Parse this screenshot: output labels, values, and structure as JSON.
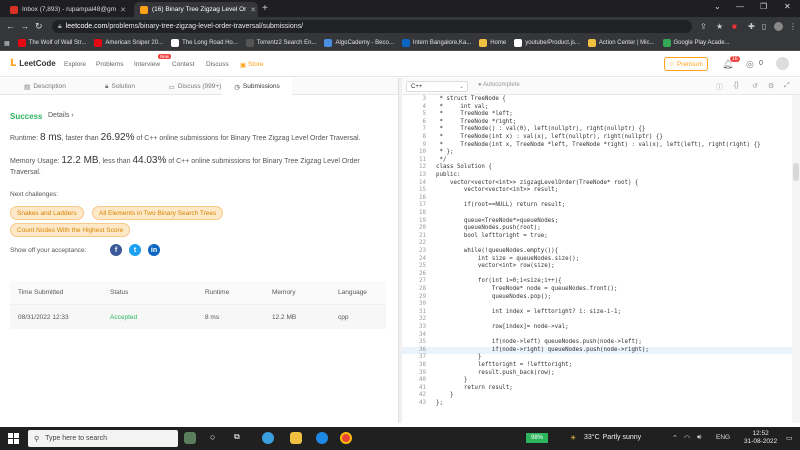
{
  "browser": {
    "tabs": [
      {
        "title": "Inbox (7,893) - rupampal48@gm",
        "favicon_color": "#d93025"
      },
      {
        "title": "(16) Binary Tree Zigzag Level Or",
        "favicon_color": "#ffa116"
      }
    ],
    "url_domain": "leetcode.com",
    "url_path": "/problems/binary-tree-zigzag-level-order-traversal/submissions/",
    "bookmarks": [
      {
        "label": "The Wolf of Wall Str...",
        "icon_color": "#e50914"
      },
      {
        "label": "American Sniper 20...",
        "icon_color": "#e50914"
      },
      {
        "label": "The Long Road Ho...",
        "icon_color": "#ffffff"
      },
      {
        "label": "Torrentz2 Search En...",
        "icon_color": "#333333"
      },
      {
        "label": "AlgoCademy - Beco...",
        "icon_color": "#4a90e2"
      },
      {
        "label": "Intern Bangalore,Ka...",
        "icon_color": "#0a66c2"
      },
      {
        "label": "Home",
        "icon_color": "#f0c040"
      },
      {
        "label": "youtube/Product.js...",
        "icon_color": "#ffffff"
      },
      {
        "label": "Action Center | Mic...",
        "icon_color": "#f0c040"
      },
      {
        "label": "Google Play Acade...",
        "icon_color": "#34a853"
      }
    ]
  },
  "leetcode": {
    "logo": "LeetCode",
    "nav": [
      {
        "label": "Explore"
      },
      {
        "label": "Problems"
      },
      {
        "label": "Interview",
        "badge": "New"
      },
      {
        "label": "Contest"
      },
      {
        "label": "Discuss"
      },
      {
        "label": "Store",
        "accent": true
      }
    ],
    "premium_label": "Premium",
    "notification_count": "16",
    "coins": "0",
    "accent_color": "#ffa116"
  },
  "left_tabs": [
    {
      "label": "Description",
      "icon": "description-icon"
    },
    {
      "label": "Solution",
      "icon": "lock-icon"
    },
    {
      "label": "Discuss (999+)",
      "icon": "discuss-icon"
    },
    {
      "label": "Submissions",
      "icon": "clock-icon"
    }
  ],
  "result": {
    "status": "Success",
    "details": "Details",
    "runtime_prefix": "Runtime: ",
    "runtime_value": "8 ms",
    "runtime_mid": ", faster than ",
    "runtime_pct": "26.92%",
    "runtime_suffix": " of C++ online submissions for Binary Tree Zigzag Level Order Traversal.",
    "memory_prefix": "Memory Usage: ",
    "memory_value": "12.2 MB",
    "memory_mid": ", less than ",
    "memory_pct": "44.03%",
    "memory_suffix": " of C++ online submissions for Binary Tree Zigzag Level Order Traversal.",
    "next_challenges_label": "Next challenges:",
    "challenges": [
      "Snakes and Ladders",
      "All Elements in Two Binary Search Trees",
      "Count Nodes With the Highest Score"
    ],
    "acceptance_label": "Show off your acceptance:"
  },
  "submissions_table": {
    "headers": [
      "Time Submitted",
      "Status",
      "Runtime",
      "Memory",
      "Language"
    ],
    "rows": [
      [
        "08/31/2022 12:33",
        "Accepted",
        "8 ms",
        "12.2 MB",
        "cpp"
      ]
    ]
  },
  "editor": {
    "language": "C++",
    "autocomplete_label": "Autocomplete",
    "lines": [
      {
        "n": "3",
        "t": " * struct TreeNode {"
      },
      {
        "n": "4",
        "t": " *     int val;"
      },
      {
        "n": "5",
        "t": " *     TreeNode *left;"
      },
      {
        "n": "6",
        "t": " *     TreeNode *right;"
      },
      {
        "n": "7",
        "t": " *     TreeNode() : val(0), left(nullptr), right(nullptr) {}"
      },
      {
        "n": "8",
        "t": " *     TreeNode(int x) : val(x), left(nullptr), right(nullptr) {}"
      },
      {
        "n": "9",
        "t": " *     TreeNode(int x, TreeNode *left, TreeNode *right) : val(x), left(left), right(right) {}"
      },
      {
        "n": "10",
        "t": " * };"
      },
      {
        "n": "11",
        "t": " */"
      },
      {
        "n": "12",
        "t": "class Solution {"
      },
      {
        "n": "13",
        "t": "public:"
      },
      {
        "n": "14",
        "t": "    vector<vector<int>> zigzagLevelOrder(TreeNode* root) {"
      },
      {
        "n": "15",
        "t": "        vector<vector<int>> result;"
      },
      {
        "n": "16",
        "t": ""
      },
      {
        "n": "17",
        "t": "        if(root==NULL) return result;"
      },
      {
        "n": "18",
        "t": ""
      },
      {
        "n": "19",
        "t": "        queue<TreeNode*>queueNodes;"
      },
      {
        "n": "20",
        "t": "        queueNodes.push(root);"
      },
      {
        "n": "21",
        "t": "        bool lefttoright = true;"
      },
      {
        "n": "22",
        "t": ""
      },
      {
        "n": "23",
        "t": "        while(!queueNodes.empty()){"
      },
      {
        "n": "24",
        "t": "            int size = queueNodes.size();"
      },
      {
        "n": "25",
        "t": "            vector<int> row(size);"
      },
      {
        "n": "26",
        "t": ""
      },
      {
        "n": "27",
        "t": "            for(int i=0;i<size;i++){"
      },
      {
        "n": "28",
        "t": "                TreeNode* node = queueNodes.front();"
      },
      {
        "n": "29",
        "t": "                queueNodes.pop();"
      },
      {
        "n": "30",
        "t": ""
      },
      {
        "n": "31",
        "t": "                int index = lefttoright? i: size-i-1;"
      },
      {
        "n": "32",
        "t": ""
      },
      {
        "n": "33",
        "t": "                row[index]= node->val;"
      },
      {
        "n": "34",
        "t": ""
      },
      {
        "n": "35",
        "t": "                if(node->left) queueNodes.push(node->left);"
      },
      {
        "n": "36",
        "t": "                if(node->right) queueNodes.push(node->right);",
        "highlight": true
      },
      {
        "n": "37",
        "t": "            }"
      },
      {
        "n": "38",
        "t": "            lefttoright = !lefttoright;"
      },
      {
        "n": "39",
        "t": "            result.push_back(row);"
      },
      {
        "n": "40",
        "t": "        }"
      },
      {
        "n": "41",
        "t": "        return result;"
      },
      {
        "n": "42",
        "t": "    }"
      },
      {
        "n": "43",
        "t": "};"
      }
    ]
  },
  "taskbar": {
    "search_placeholder": "Type here to search",
    "battery": "98%",
    "weather_temp": "33°C",
    "weather_desc": "Partly sunny",
    "lang": "ENG",
    "time": "12:52",
    "date": "31-08-2022"
  }
}
